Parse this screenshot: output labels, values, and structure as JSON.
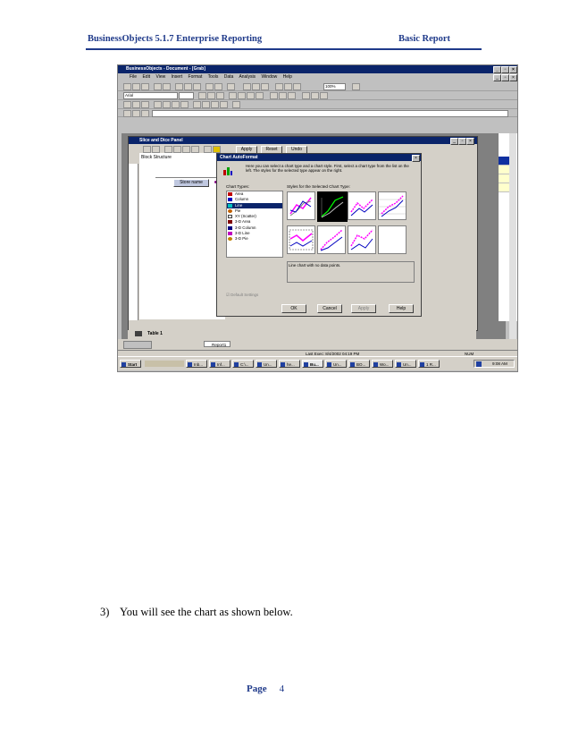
{
  "header": {
    "left": "BusinessObjects 5.1.7 Enterprise Reporting",
    "right": "Basic Report"
  },
  "screenshot": {
    "app_title": "BusinessObjects - Document - [Grab]",
    "menu": [
      "File",
      "Edit",
      "View",
      "Insert",
      "Format",
      "Tools",
      "Data",
      "Analysis",
      "Window",
      "Help"
    ],
    "zoom": "100%",
    "font_combo": "Arial",
    "slice_panel": {
      "title": "Slice and Dice Panel",
      "apply": "Apply",
      "reset": "Reset",
      "undo": "Undo",
      "block_structure": "Block Structure",
      "store_name": "Store name",
      "tab": "Table 1"
    },
    "dialog": {
      "title": "Chart AutoFormat",
      "intro": "Here you can select a chart type and a chart style. First, select a chart type from the list on the left. The styles for the selected type appear on the right.",
      "types_label": "Chart Types:",
      "styles_label": "Styles for the Selected Chart Type:",
      "types": [
        "Area",
        "Column",
        "Line",
        "Pie",
        "XY (Scatter)",
        "3-D Area",
        "3-D Column",
        "3-D Line",
        "3-D Pie"
      ],
      "selected_type": "Line",
      "description": "Line chart with no data points.",
      "default_settings": "Default Settings",
      "ok": "OK",
      "cancel": "Cancel",
      "apply": "Apply",
      "help": "Help"
    },
    "report_tab": "Report1",
    "status": {
      "last_exec": "Last Exec: 8/4/2002  04:19 PM",
      "num": "NUM"
    },
    "taskbar": {
      "start": "Start",
      "tasks": [
        "Inb...",
        "Inf...",
        "C:\\...",
        "Un...",
        "he...",
        "Bu...",
        "Un...",
        "BO...",
        "Wo...",
        "Un...",
        "1 R..."
      ],
      "clock": "9:08 AM"
    }
  },
  "step": {
    "number": "3)",
    "text": "You will see the chart as shown below."
  },
  "footer": {
    "label": "Page",
    "number": "4"
  }
}
